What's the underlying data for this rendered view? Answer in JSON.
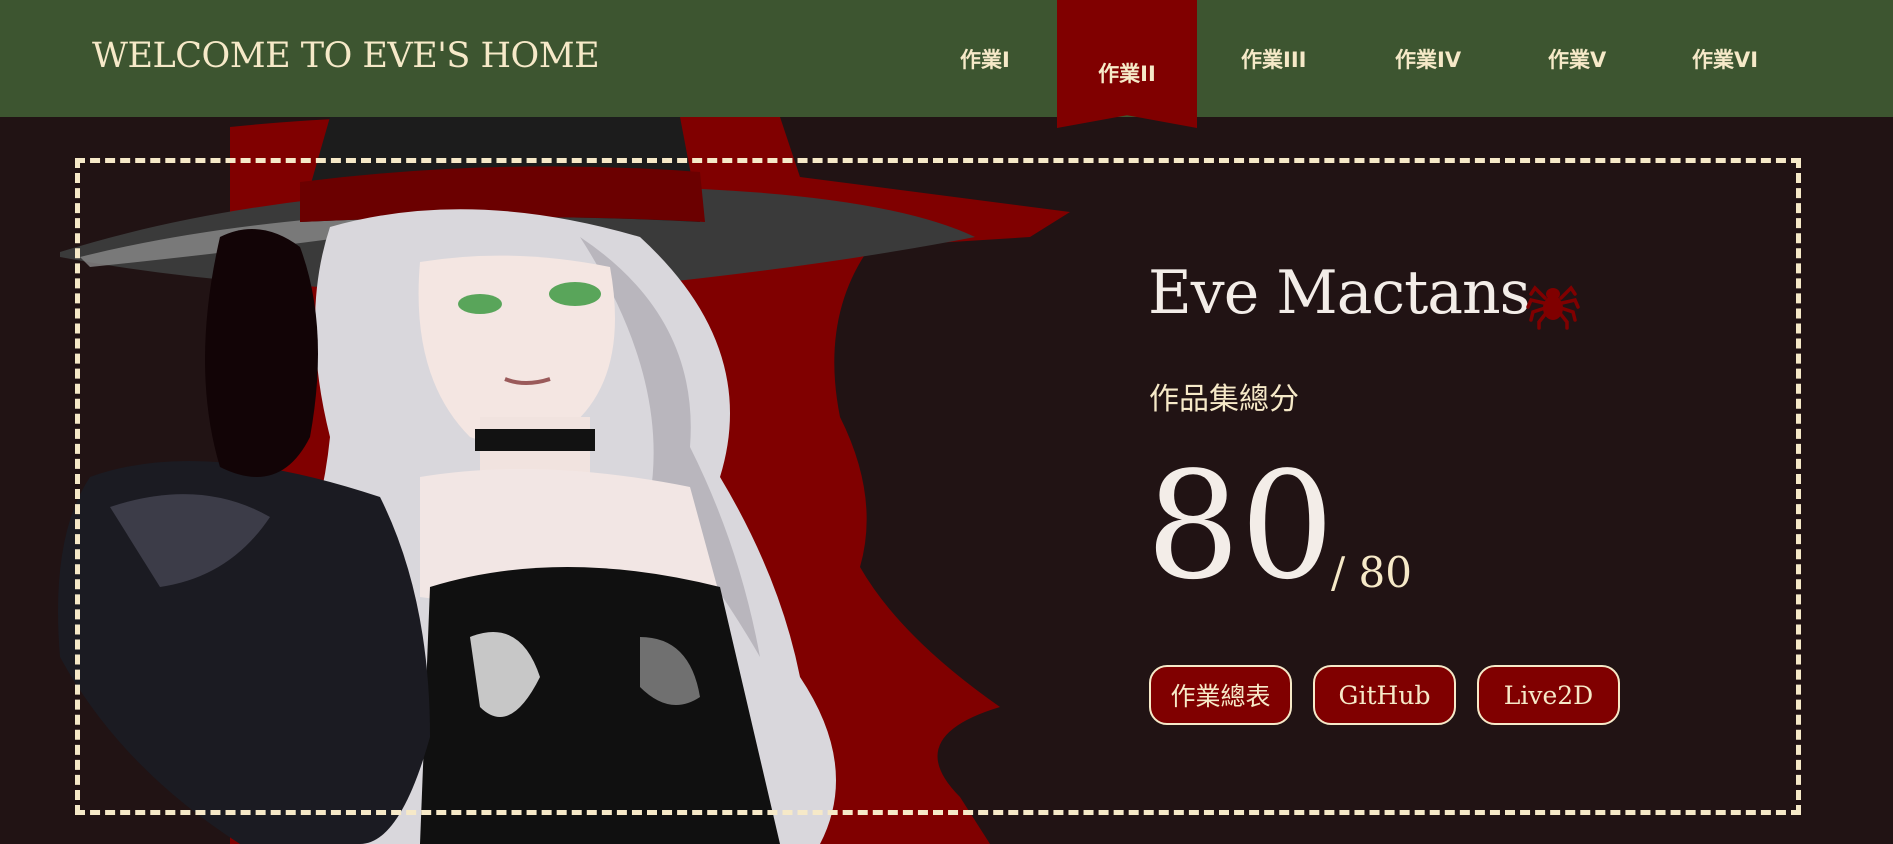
{
  "header": {
    "site_title": "WELCOME TO EVE'S HOME",
    "nav": [
      "作業I",
      "作業II",
      "作業III",
      "作業IV",
      "作業V",
      "作業VI"
    ],
    "active_nav": "作業II"
  },
  "profile": {
    "name": "Eve Mactans",
    "subtitle": "作品集總分",
    "score": "80",
    "score_total": "/ 80"
  },
  "buttons": [
    "作業總表",
    "GitHub",
    "Live2D"
  ],
  "icons": {
    "name_badge": "spider-icon",
    "hero": "witch-character-illustration"
  },
  "colors": {
    "header_bg": "#3d5530",
    "page_bg": "#211314",
    "accent_red": "#800000",
    "cream": "#f6e9c8",
    "name_text": "#f3ede8"
  }
}
